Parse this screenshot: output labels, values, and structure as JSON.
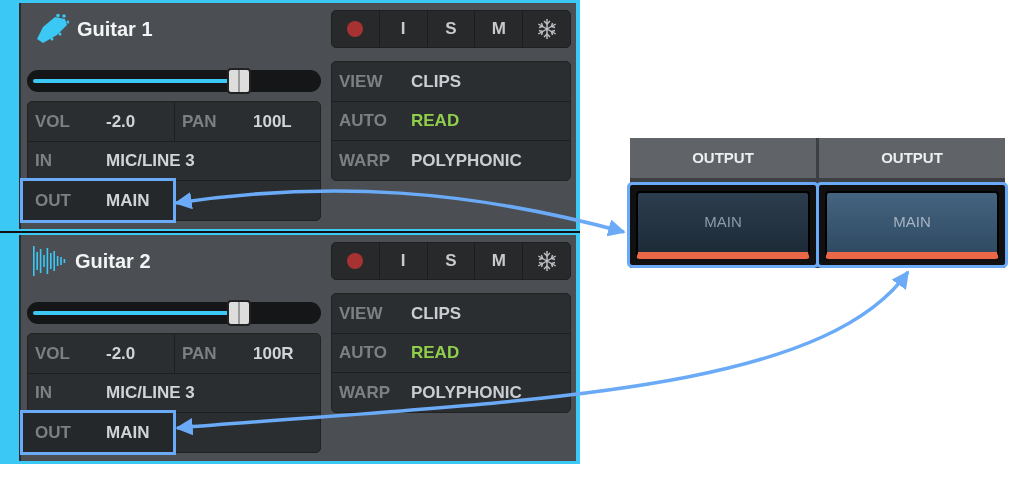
{
  "tracks": [
    {
      "name": "Guitar 1",
      "kind": "guitar",
      "level": 0.72,
      "arrow_to_output": true,
      "buttons": [
        {
          "kind": "record"
        },
        {
          "kind": "letter",
          "label": "I"
        },
        {
          "kind": "letter",
          "label": "S"
        },
        {
          "kind": "letter",
          "label": "M"
        },
        {
          "kind": "freeze"
        }
      ],
      "mix": [
        {
          "label": "VOL",
          "value": "-2.0"
        },
        {
          "label": "PAN",
          "value": "100L"
        },
        {
          "label": "IN",
          "value": "MIC/LINE 3"
        },
        {
          "label": "OUT",
          "value": "MAIN",
          "highlighted": true
        }
      ],
      "info": [
        {
          "label": "VIEW",
          "value": "CLIPS",
          "color": "#c9ced2"
        },
        {
          "label": "AUTO",
          "value": "READ",
          "color": "#8fcf4a"
        },
        {
          "label": "WARP",
          "value": "POLYPHONIC",
          "color": "#c9ced2"
        }
      ]
    },
    {
      "name": "Guitar 2",
      "kind": "waveform",
      "level": 0.72,
      "arrow_to_output": true,
      "buttons": [
        {
          "kind": "record"
        },
        {
          "kind": "letter",
          "label": "I"
        },
        {
          "kind": "letter",
          "label": "S"
        },
        {
          "kind": "letter",
          "label": "M"
        },
        {
          "kind": "freeze"
        }
      ],
      "mix": [
        {
          "label": "VOL",
          "value": "-2.0"
        },
        {
          "label": "PAN",
          "value": "100R"
        },
        {
          "label": "IN",
          "value": "MIC/LINE 3"
        },
        {
          "label": "OUT",
          "value": "MAIN",
          "highlighted": true
        }
      ],
      "info": [
        {
          "label": "VIEW",
          "value": "CLIPS",
          "color": "#c9ced2"
        },
        {
          "label": "AUTO",
          "value": "READ",
          "color": "#8fcf4a"
        },
        {
          "label": "WARP",
          "value": "POLYPHONIC",
          "color": "#c9ced2"
        }
      ]
    }
  ],
  "outputs": [
    {
      "header": "OUTPUT",
      "value": "MAIN",
      "selected": false,
      "highlighted": true
    },
    {
      "header": "OUTPUT",
      "value": "MAIN",
      "selected": true,
      "highlighted": true
    }
  ]
}
